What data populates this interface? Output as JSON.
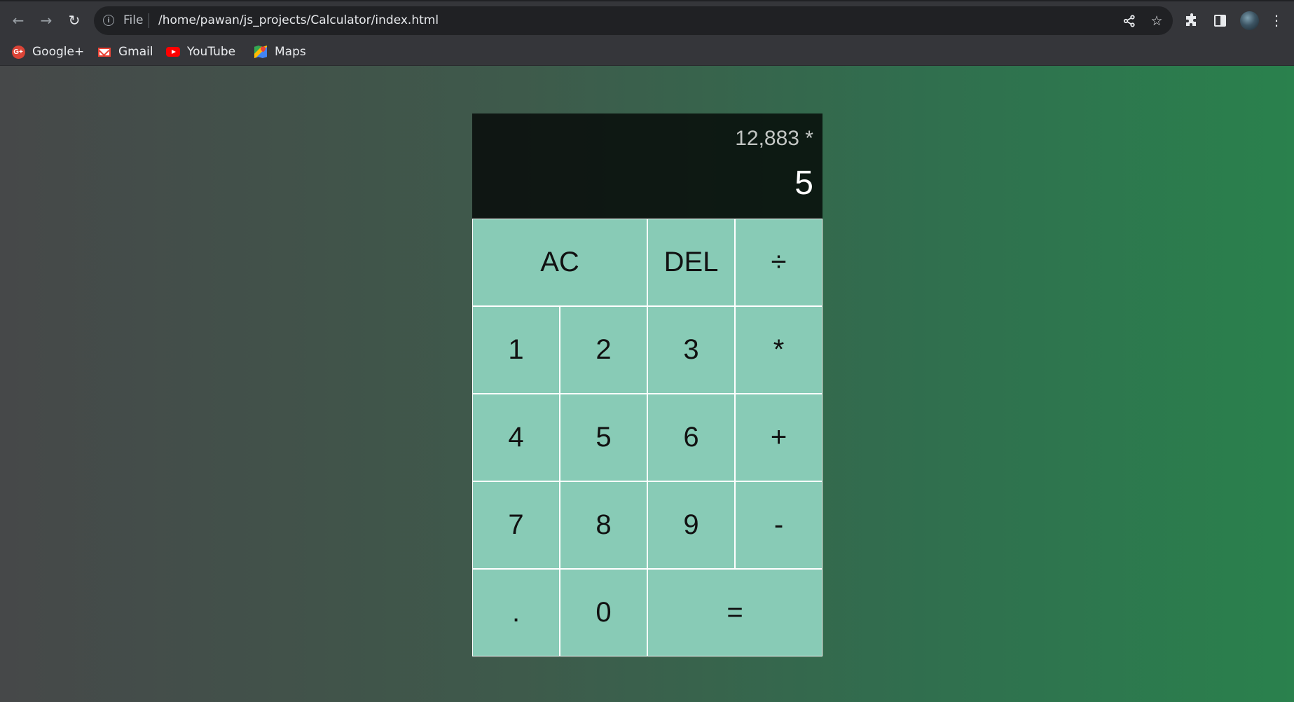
{
  "browser": {
    "url_scheme_label": "File",
    "url": "/home/pawan/js_projects/Calculator/index.html",
    "bookmarks": [
      {
        "label": "Google+",
        "icon": "google-plus-icon"
      },
      {
        "label": "Gmail",
        "icon": "gmail-icon"
      },
      {
        "label": "YouTube",
        "icon": "youtube-icon"
      },
      {
        "label": "Maps",
        "icon": "maps-icon"
      }
    ]
  },
  "calculator": {
    "previous_operand": "12,883 *",
    "current_operand": "5",
    "keys": {
      "ac": "AC",
      "del": "DEL",
      "divide": "÷",
      "one": "1",
      "two": "2",
      "three": "3",
      "multiply": "*",
      "four": "4",
      "five": "5",
      "six": "6",
      "add": "+",
      "seven": "7",
      "eight": "8",
      "nine": "9",
      "subtract": "-",
      "decimal": ".",
      "zero": "0",
      "equals": "="
    }
  },
  "colors": {
    "key_background": "#88cbb6",
    "key_border": "#ffffff",
    "display_background": "rgba(0,0,0,0.75)",
    "page_gradient": [
      "#464849",
      "#2a814d"
    ],
    "chrome_toolbar": "#35363a",
    "omnibox": "#202124"
  }
}
